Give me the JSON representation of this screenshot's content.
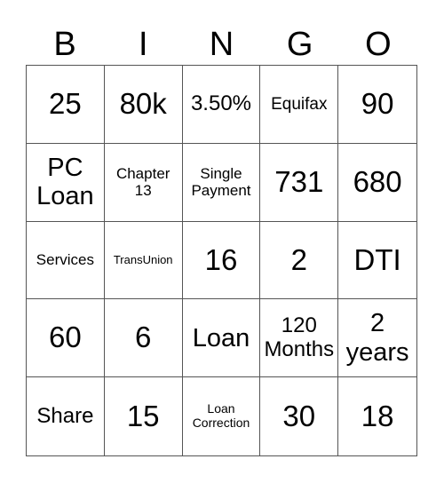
{
  "header": {
    "letters": [
      "B",
      "I",
      "N",
      "G",
      "O"
    ]
  },
  "cells": [
    {
      "text": "25",
      "size": "s-xl"
    },
    {
      "text": "80k",
      "size": "s-xl"
    },
    {
      "text": "3.50%",
      "size": "s-m"
    },
    {
      "text": "Equifax",
      "size": "s-sm"
    },
    {
      "text": "90",
      "size": "s-xl"
    },
    {
      "text": "PC Loan",
      "size": "s-l"
    },
    {
      "text": "Chapter 13",
      "size": "s-s"
    },
    {
      "text": "Single Payment",
      "size": "s-s"
    },
    {
      "text": "731",
      "size": "s-xl"
    },
    {
      "text": "680",
      "size": "s-xl"
    },
    {
      "text": "Services",
      "size": "s-s"
    },
    {
      "text": "TransUnion",
      "size": "s-xxs"
    },
    {
      "text": "16",
      "size": "s-xl"
    },
    {
      "text": "2",
      "size": "s-xl"
    },
    {
      "text": "DTI",
      "size": "s-xl"
    },
    {
      "text": "60",
      "size": "s-xl"
    },
    {
      "text": "6",
      "size": "s-xl"
    },
    {
      "text": "Loan",
      "size": "s-l"
    },
    {
      "text": "120 Months",
      "size": "s-m"
    },
    {
      "text": "2 years",
      "size": "s-l"
    },
    {
      "text": "Share",
      "size": "s-m"
    },
    {
      "text": "15",
      "size": "s-xl"
    },
    {
      "text": "Loan Correction",
      "size": "s-xs"
    },
    {
      "text": "30",
      "size": "s-xl"
    },
    {
      "text": "18",
      "size": "s-xl"
    }
  ]
}
